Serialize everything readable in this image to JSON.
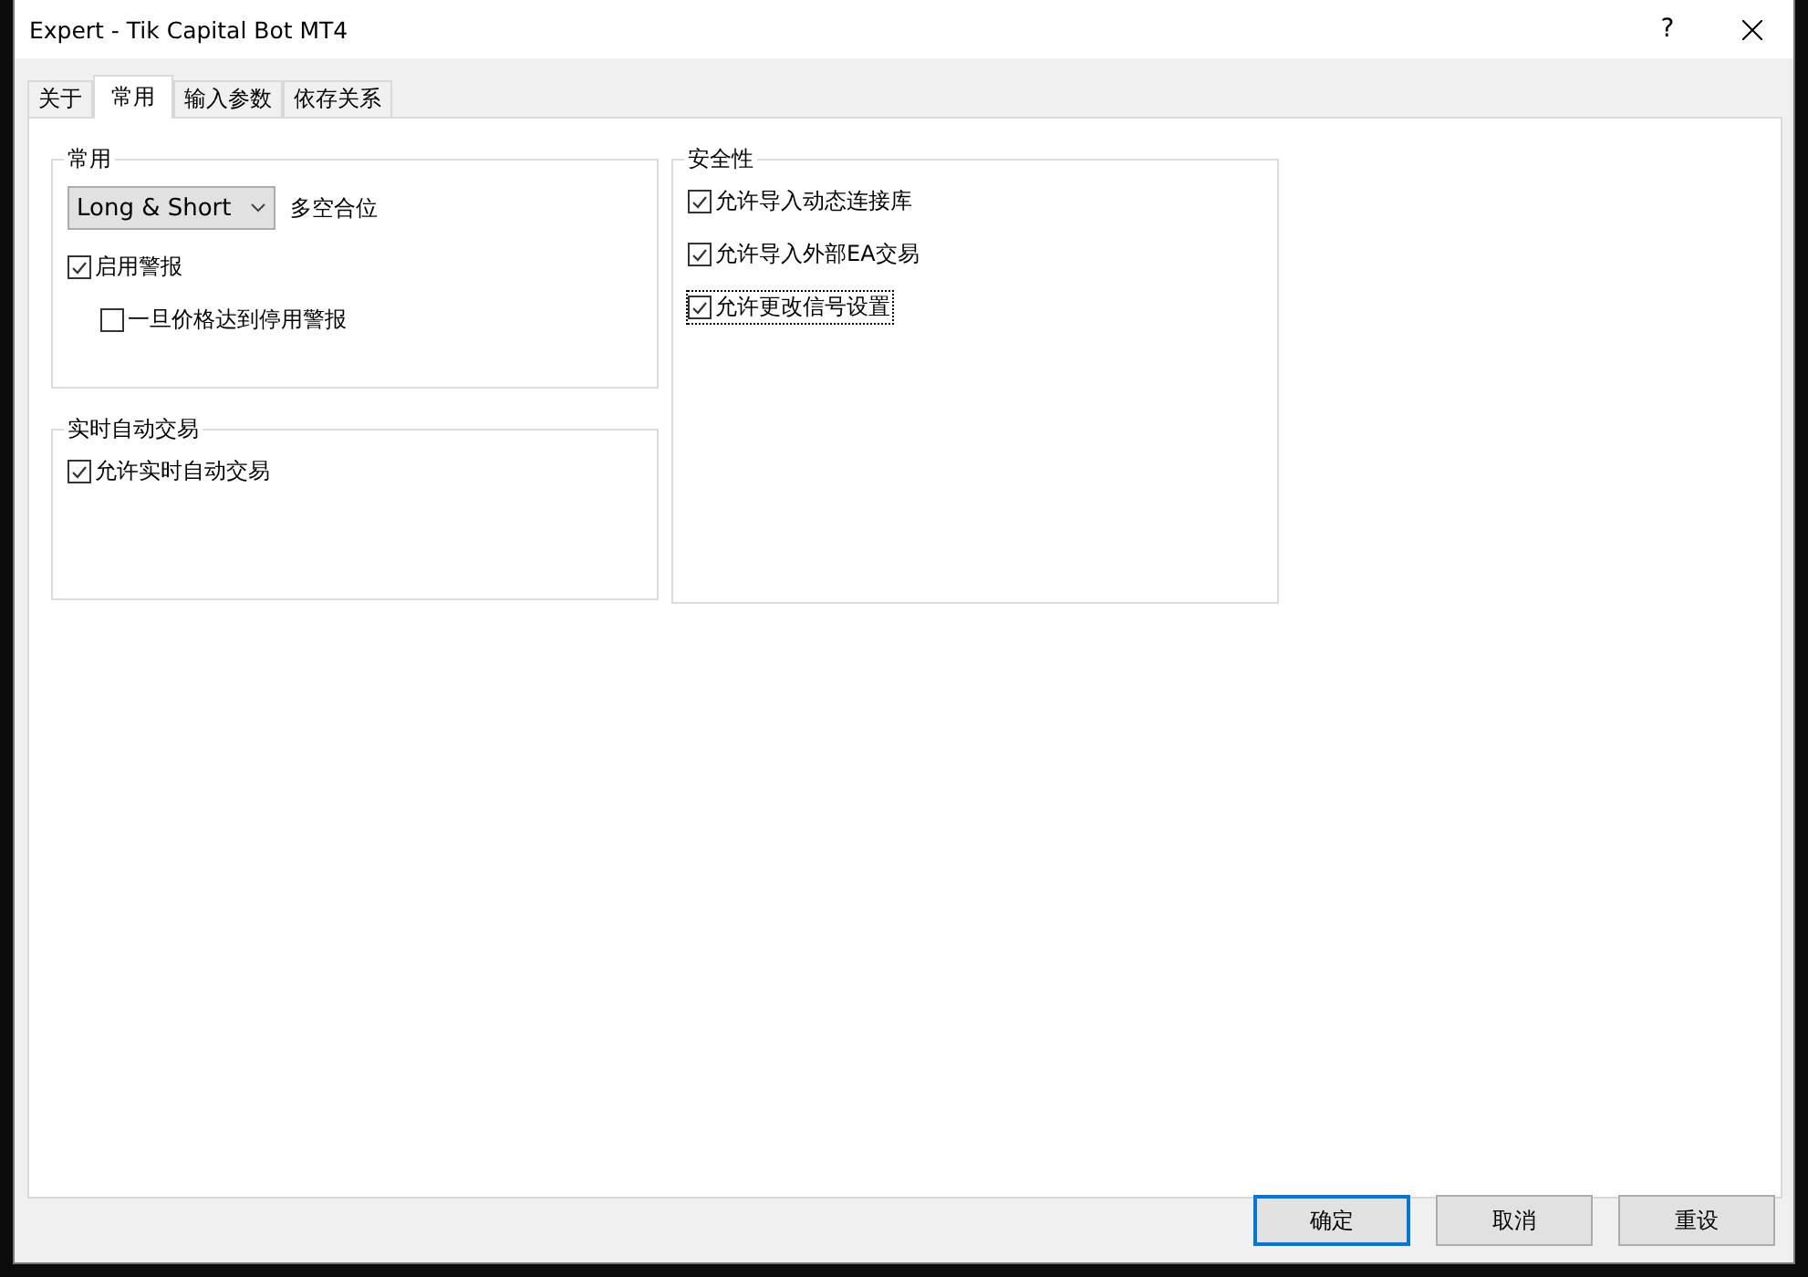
{
  "window": {
    "title": "Expert - Tik Capital Bot MT4",
    "help": "?"
  },
  "tabs": [
    {
      "label": "关于",
      "selected": false
    },
    {
      "label": "常用",
      "selected": true
    },
    {
      "label": "输入参数",
      "selected": false
    },
    {
      "label": "依存关系",
      "selected": false
    }
  ],
  "left_groups": [
    {
      "title": "常用",
      "items": [
        {
          "kind": "dropdown",
          "value": "Long & Short",
          "label": "多空合位"
        },
        {
          "kind": "checkbox",
          "label": "启用警报",
          "checked": true,
          "focused": false,
          "children": [
            {
              "kind": "checkbox",
              "label": "一旦价格达到停用警报",
              "checked": false,
              "focused": false
            }
          ]
        }
      ]
    },
    {
      "title": "实时自动交易",
      "items": [
        {
          "kind": "checkbox",
          "label": "允许实时自动交易",
          "checked": true,
          "focused": false
        }
      ]
    }
  ],
  "right_groups": [
    {
      "title": "安全性",
      "items": [
        {
          "kind": "checkbox",
          "label": "允许导入动态连接库",
          "checked": true,
          "focused": false
        },
        {
          "kind": "checkbox",
          "label": "允许导入外部EA交易",
          "checked": true,
          "focused": false
        },
        {
          "kind": "checkbox",
          "label": "允许更改信号设置",
          "checked": true,
          "focused": true
        }
      ]
    }
  ],
  "buttons": [
    {
      "label": "确定",
      "default": true
    },
    {
      "label": "取消",
      "default": false
    },
    {
      "label": "重设",
      "default": false
    }
  ]
}
